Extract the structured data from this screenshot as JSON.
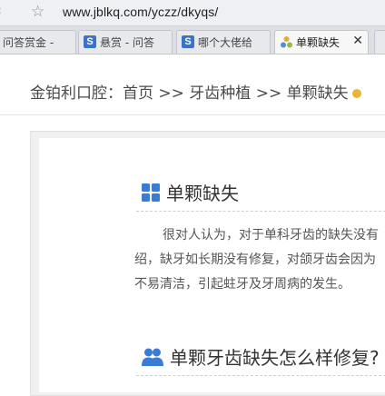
{
  "browser": {
    "url": "www.jblkq.com/yczz/dkyqs/",
    "tabs": [
      {
        "label": "问答赏金 - ",
        "icon": "page-icon"
      },
      {
        "label": "悬赏 - 问答",
        "icon": "sogou-s-icon"
      },
      {
        "label": "哪个大佬给",
        "icon": "sogou-s-icon"
      },
      {
        "label": "单颗缺失",
        "icon": "site-logo-icon",
        "active": true,
        "close": "✕"
      }
    ]
  },
  "breadcrumb": {
    "site": "金铂利口腔：",
    "home": "首页",
    "sep1": " >> ",
    "category": "牙齿种植",
    "sep2": " >> ",
    "current": "单颗缺失"
  },
  "section1": {
    "title": "单颗缺失",
    "lines": [
      "很对人认为，对于单科牙齿的缺失没有",
      "绍，缺牙如长期没有修复，对颌牙齿会因为",
      "不易清洁，引起蛀牙及牙周病的发生。"
    ]
  },
  "section2": {
    "title": "单颗牙齿缺失怎么样修复?"
  },
  "colors": {
    "accent_blue": "#3a7bd5",
    "text": "#555555",
    "panel": "#f0f0f0"
  }
}
